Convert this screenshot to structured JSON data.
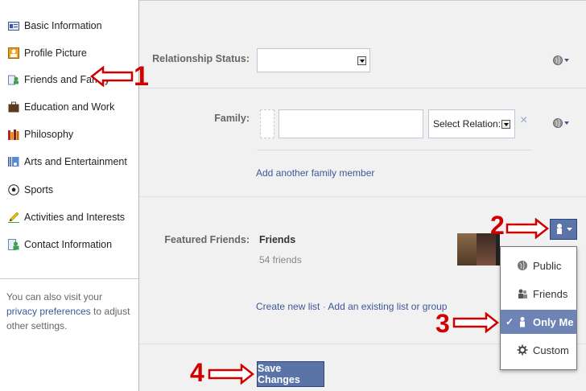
{
  "sidebar": {
    "items": [
      {
        "label": "Basic Information",
        "icon": "id-card-icon"
      },
      {
        "label": "Profile Picture",
        "icon": "profile-picture-icon"
      },
      {
        "label": "Friends and Family",
        "icon": "friends-icon"
      },
      {
        "label": "Education and Work",
        "icon": "briefcase-icon"
      },
      {
        "label": "Philosophy",
        "icon": "books-icon"
      },
      {
        "label": "Arts and Entertainment",
        "icon": "music-icon"
      },
      {
        "label": "Sports",
        "icon": "soccer-ball-icon"
      },
      {
        "label": "Activities and Interests",
        "icon": "pencil-icon"
      },
      {
        "label": "Contact Information",
        "icon": "contact-icon"
      }
    ],
    "note_prefix": "You can also visit your ",
    "note_link": "privacy preferences",
    "note_suffix": " to adjust other settings."
  },
  "form": {
    "relationship_label": "Relationship Status:",
    "relationship_value": "",
    "family_label": "Family:",
    "family_name_value": "",
    "family_relation_value": "Select Relation:",
    "remove_glyph": "×",
    "add_family_link": "Add another family member",
    "featured_label": "Featured Friends:",
    "featured_list_name": "Friends",
    "featured_count": "54 friends",
    "create_list_link": "Create new list",
    "separator": "·",
    "add_existing_link": "Add an existing list or group",
    "save_label": "Save Changes"
  },
  "privacy_menu": {
    "options": [
      {
        "label": "Public",
        "icon": "globe-icon",
        "selected": false
      },
      {
        "label": "Friends",
        "icon": "friends-icon",
        "selected": false
      },
      {
        "label": "Only Me",
        "icon": "lock-person-icon",
        "selected": true
      },
      {
        "label": "Custom",
        "icon": "gear-icon",
        "selected": false
      }
    ],
    "check_glyph": "✓"
  },
  "annotations": {
    "a1": "1",
    "a2": "2",
    "a3": "3",
    "a4": "4"
  },
  "colors": {
    "link": "#3b5998",
    "button": "#5b74a8",
    "selected": "#6d84b4",
    "annotation": "#d10000",
    "panel": "#f1f1f1"
  }
}
